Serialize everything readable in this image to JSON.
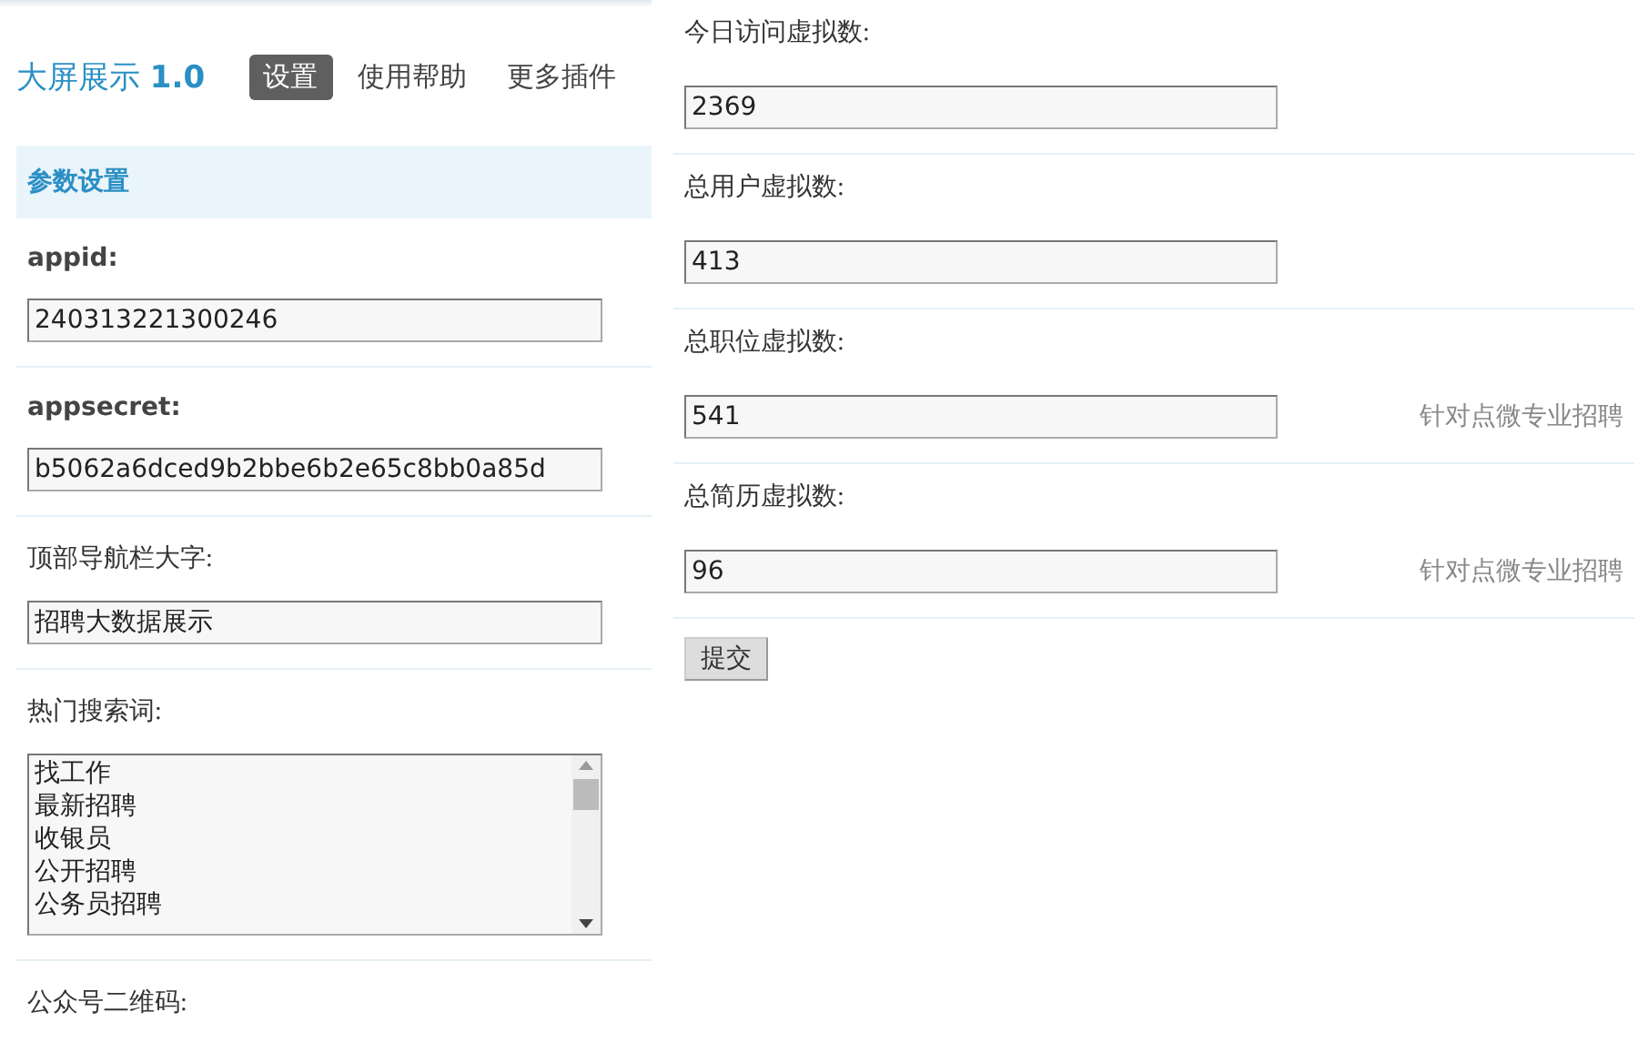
{
  "header": {
    "title": "大屏展示",
    "version": "1.0"
  },
  "tabs": [
    {
      "label": "设置",
      "selected": true
    },
    {
      "label": "使用帮助",
      "selected": false
    },
    {
      "label": "更多插件",
      "selected": false
    }
  ],
  "section_title": "参数设置",
  "left_fields": [
    {
      "kind": "text",
      "label": "appid:",
      "bold": true,
      "value": "240313221300246"
    },
    {
      "kind": "text",
      "label": "appsecret:",
      "bold": true,
      "value": "b5062a6dced9b2bbe6b2e65c8bb0a85d"
    },
    {
      "kind": "text",
      "label": "顶部导航栏大字:",
      "bold": false,
      "value": "招聘大数据展示"
    },
    {
      "kind": "list",
      "label": "热门搜索词:",
      "bold": false,
      "items": [
        "找工作",
        "最新招聘",
        "收银员",
        "公开招聘",
        "公务员招聘"
      ]
    },
    {
      "kind": "label",
      "label": "公众号二维码:",
      "bold": false
    }
  ],
  "right_fields": [
    {
      "label": "今日访问虚拟数:",
      "value": "2369"
    },
    {
      "label": "总用户虚拟数:",
      "value": "413"
    },
    {
      "label": "总职位虚拟数:",
      "value": "541",
      "hint": "针对点微专业招聘"
    },
    {
      "label": "总简历虚拟数:",
      "value": "96",
      "hint": "针对点微专业招聘"
    }
  ],
  "submit_button": "提交"
}
